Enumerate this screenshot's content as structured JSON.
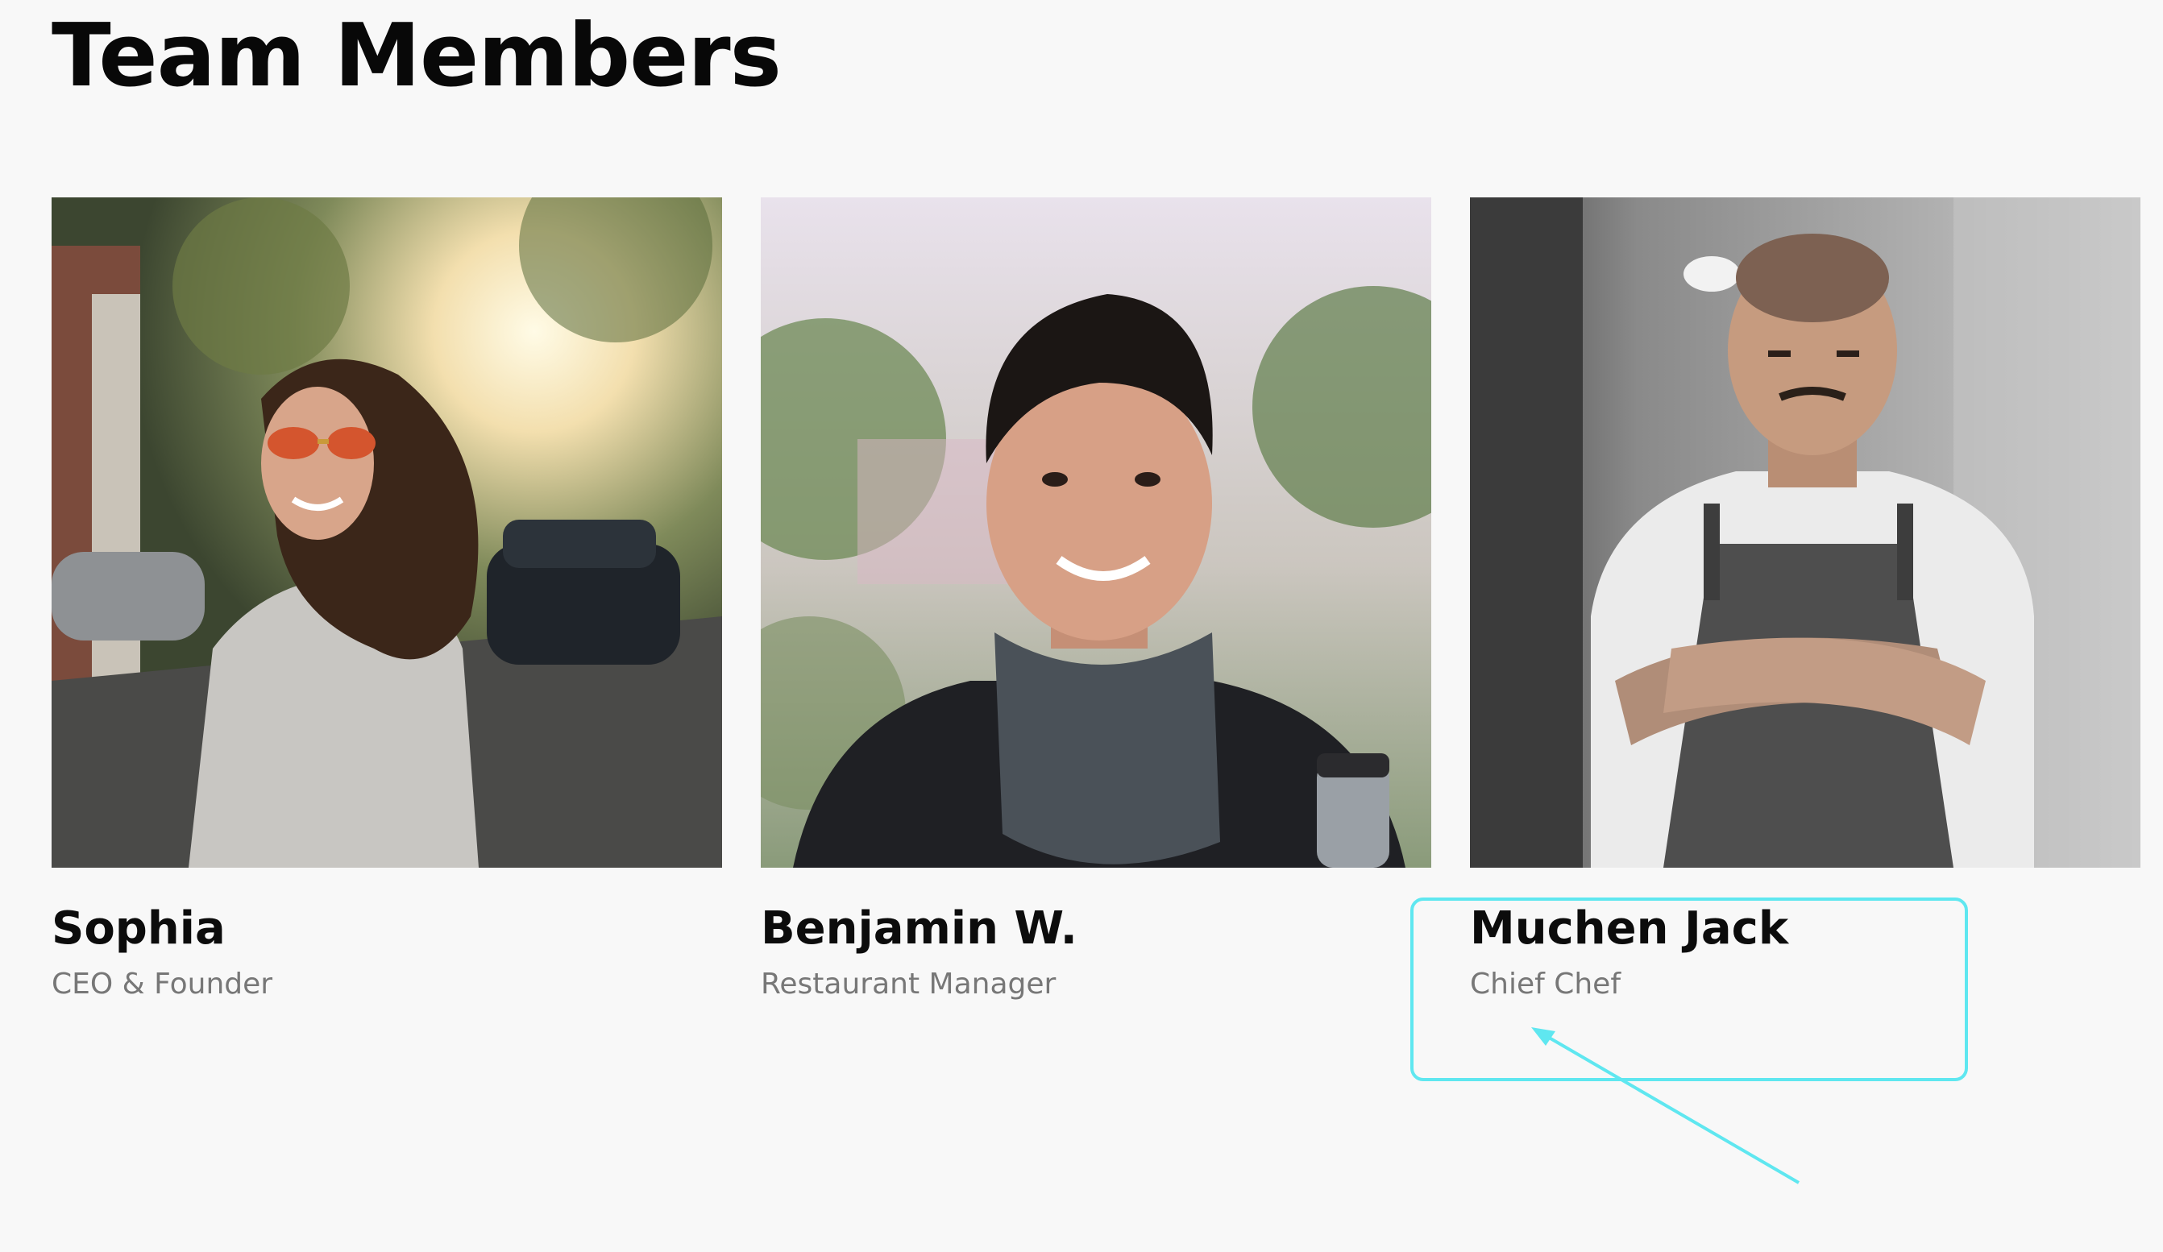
{
  "page": {
    "title": "Team Members"
  },
  "members": [
    {
      "name": "Sophia",
      "role": "CEO & Founder",
      "photo_icon": "woman-sunglasses-photo"
    },
    {
      "name": "Benjamin W.",
      "role": "Restaurant Manager",
      "photo_icon": "man-scarf-photo"
    },
    {
      "name": "Muchen Jack",
      "role": "Chief Chef",
      "photo_icon": "chef-apron-photo"
    }
  ],
  "annotation": {
    "highlight_color": "#5fe7f0"
  }
}
